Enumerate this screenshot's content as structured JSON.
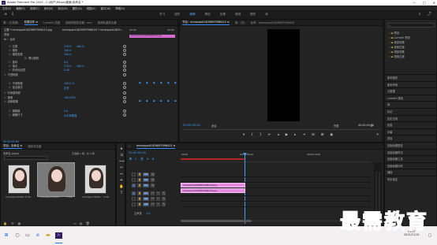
{
  "window": {
    "title": "Adobe Premiere Pro 2020 - C:\\用户\\Ethan\\桌面\\未命名 *",
    "controls": [
      "—",
      "□",
      "✕"
    ]
  },
  "menu": [
    "文件(F)",
    "编辑(E)",
    "剪辑(C)",
    "序列(S)",
    "标记(M)",
    "图形(G)",
    "视图(V)",
    "窗口(W)",
    "帮助(H)"
  ],
  "workspaces": {
    "tabs": [
      "学习",
      "组件",
      "编辑",
      "颜色",
      "效果",
      "音频",
      "图形",
      "库"
    ],
    "active_index": 2
  },
  "effect_controls": {
    "tabs": [
      "源：(无剪辑)",
      "效果控件 ≡",
      "Lumetri 范围",
      "音频剪辑混合器：mm",
      "音频轨道混合器"
    ],
    "source_label": "主要 * mmexport1629897996415.jpg",
    "sequence_label": "mmexport1629897996415 * mmexport1629...",
    "timecode_start": "00:00",
    "timecode_end": "00:00",
    "clip_name": "mmexport1629897996415.jpg",
    "section_video": "视频",
    "section_motion": "运动",
    "properties": [
      {
        "name": "位置",
        "value": "270.0",
        "value2": "480.0"
      },
      {
        "name": "缩放",
        "value": "100.0"
      },
      {
        "name": "缩放宽度",
        "value": "100.0"
      },
      {
        "name": "",
        "value": "",
        "checkbox_label": "等比缩放"
      },
      {
        "name": "旋转",
        "value": "0.0"
      },
      {
        "name": "锚点",
        "value": "270.0",
        "value2": "480.0"
      },
      {
        "name": "防闪烁滤镜",
        "value": "0.00"
      },
      {
        "name": "不透明度",
        "value": ""
      },
      {
        "name": "",
        "value": ""
      },
      {
        "name": "不透明度",
        "value": "100.0 %"
      },
      {
        "name": "混合模式",
        "value": "正常"
      },
      {
        "name": "时间重映射",
        "value": ""
      },
      {
        "name": "速度",
        "value": "100.00%"
      },
      {
        "name": "高斯模糊",
        "value": ""
      },
      {
        "name": "",
        "value": ""
      },
      {
        "name": "模糊度",
        "value": "0.0"
      },
      {
        "name": "模糊尺寸",
        "value": "水平和垂直"
      }
    ],
    "current_time": "00:00:05:00"
  },
  "program": {
    "tabs": [
      "节目：mmexport1629897996415 ≡",
      "源：(无)",
      "参考：mmexport1629897996415"
    ],
    "timecode": "00:00:05:00",
    "fit": "适合",
    "quality": "完整",
    "duration": "00:00:05:00"
  },
  "right_panel": {
    "effects_items": [
      "预设",
      "Lumetri 预设",
      "音频效果",
      "音频过渡",
      "视频效果",
      "视频过渡"
    ],
    "sections": [
      "基本图形",
      "基本声音",
      "元数据",
      "Lumetri 颜色",
      "库",
      "标记",
      "历史记录",
      "信息",
      "字幕",
      "项目",
      "旧版标题属性",
      "旧版标题样式",
      "旧版标题工具",
      "旧版标题动作",
      "捕捉",
      "同步锁定"
    ],
    "search_icon": "search-icon"
  },
  "project": {
    "tabs": [
      "项目：未命名 ≡",
      "媒体浏览器"
    ],
    "path": "未命名.prproj",
    "selected_count": "已选择 1 项，共 3 项",
    "items": [
      {
        "name": "mmexport1629...",
        "duration": "5:00"
      },
      {
        "name": "mmexport1629...",
        "duration": "5:00"
      },
      {
        "name": "mmexport1629...",
        "duration": "5:00"
      }
    ]
  },
  "timeline": {
    "tab": "mmexport1629897996415 ≡",
    "timecode": "00:00:05:00",
    "ruler_start": "00:00",
    "ruler_mid": "00:00:05:00",
    "ruler_end": "00:00:10:00",
    "tracks_video": [
      "V3",
      "V2",
      "V1"
    ],
    "tracks_audio": [
      "A1",
      "A2",
      "A3"
    ],
    "master": "主声道",
    "master_value": "0.0",
    "clips": [
      "mmexport1629897996415.jpg",
      "mmexport1629897996415.jpg"
    ]
  },
  "taskbar": {
    "time": "11:27",
    "date": "2021/11/15"
  },
  "watermark": "最需教育"
}
